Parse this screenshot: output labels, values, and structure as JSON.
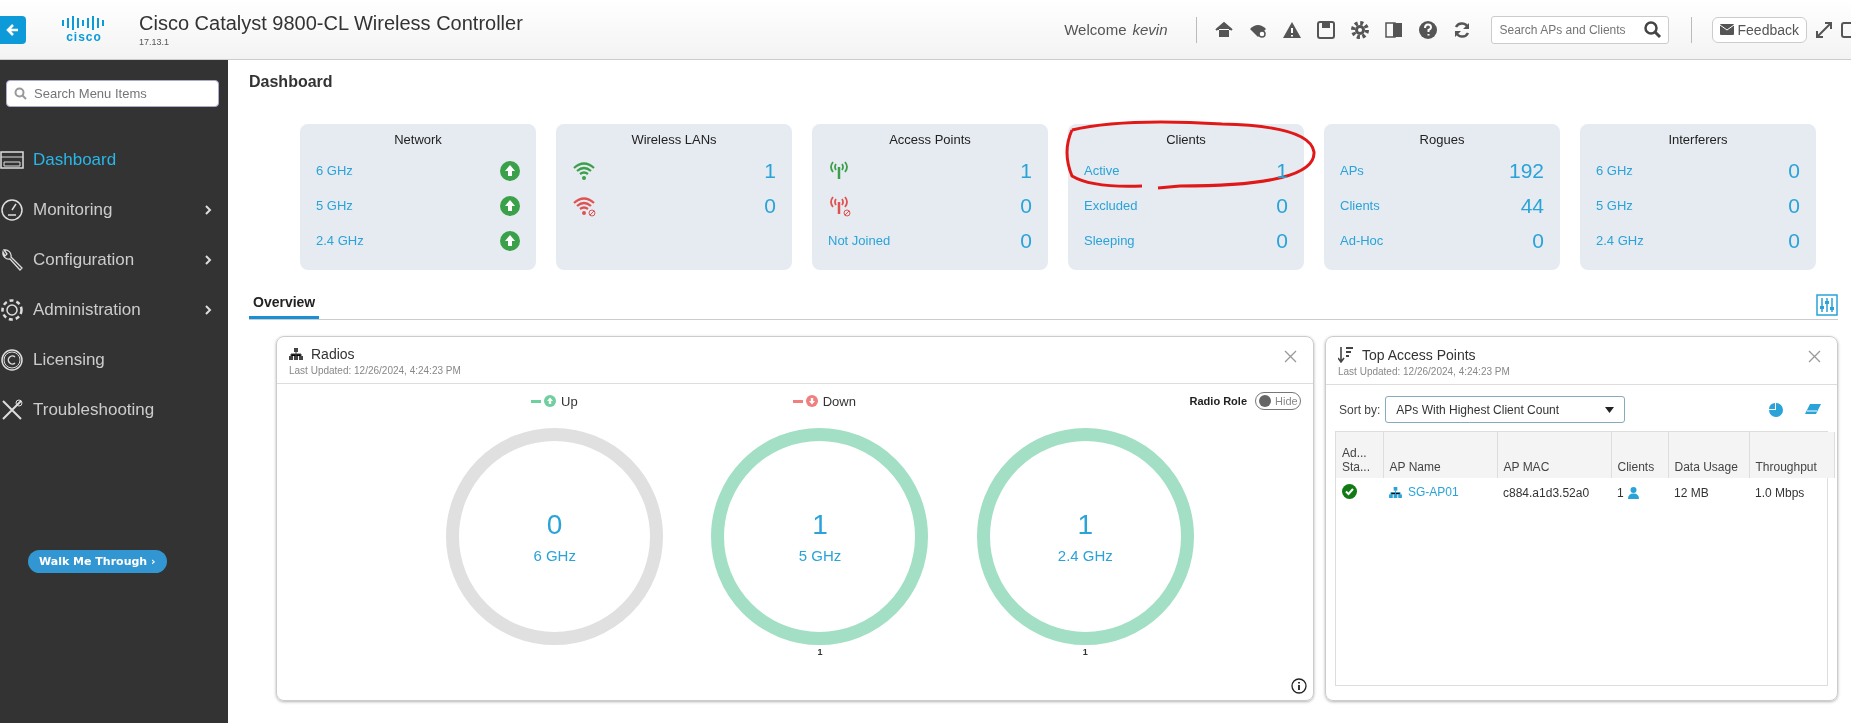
{
  "header": {
    "logo_text": "cisco",
    "version": "17.13.1",
    "title": "Cisco Catalyst 9800-CL Wireless Controller",
    "welcome": "Welcome",
    "user": "kevin",
    "search_placeholder": "Search APs and Clients",
    "feedback": "Feedback"
  },
  "sidebar": {
    "search_placeholder": "Search Menu Items",
    "items": [
      {
        "label": "Dashboard",
        "selected": true,
        "expandable": false
      },
      {
        "label": "Monitoring",
        "selected": false,
        "expandable": true
      },
      {
        "label": "Configuration",
        "selected": false,
        "expandable": true
      },
      {
        "label": "Administration",
        "selected": false,
        "expandable": true
      },
      {
        "label": "Licensing",
        "selected": false,
        "expandable": false
      },
      {
        "label": "Troubleshooting",
        "selected": false,
        "expandable": false
      }
    ],
    "walk_button": "Walk Me Through ›"
  },
  "page_title": "Dashboard",
  "cards": [
    {
      "title": "Network",
      "annotated": false,
      "rows": [
        {
          "kind": "status",
          "label": "6 GHz",
          "up": true
        },
        {
          "kind": "status",
          "label": "5 GHz",
          "up": true
        },
        {
          "kind": "status",
          "label": "2.4 GHz",
          "up": true
        }
      ]
    },
    {
      "title": "Wireless LANs",
      "annotated": false,
      "rows": [
        {
          "kind": "wifi",
          "enabled": true,
          "value": "1"
        },
        {
          "kind": "wifi",
          "enabled": false,
          "value": "0"
        }
      ]
    },
    {
      "title": "Access Points",
      "annotated": false,
      "rows": [
        {
          "kind": "antenna",
          "enabled": true,
          "value": "1"
        },
        {
          "kind": "antenna",
          "enabled": false,
          "value": "0"
        },
        {
          "kind": "metric",
          "label": "Not Joined",
          "value": "0"
        }
      ]
    },
    {
      "title": "Clients",
      "annotated": true,
      "rows": [
        {
          "kind": "metric",
          "label": "Active",
          "value": "1"
        },
        {
          "kind": "metric",
          "label": "Excluded",
          "value": "0"
        },
        {
          "kind": "metric",
          "label": "Sleeping",
          "value": "0"
        }
      ]
    },
    {
      "title": "Rogues",
      "annotated": false,
      "rows": [
        {
          "kind": "metric",
          "label": "APs",
          "value": "192"
        },
        {
          "kind": "metric",
          "label": "Clients",
          "value": "44"
        },
        {
          "kind": "metric",
          "label": "Ad-Hoc",
          "value": "0"
        }
      ]
    },
    {
      "title": "Interferers",
      "annotated": false,
      "rows": [
        {
          "kind": "metric",
          "label": "6 GHz",
          "value": "0"
        },
        {
          "kind": "metric",
          "label": "5 GHz",
          "value": "0"
        },
        {
          "kind": "metric",
          "label": "2.4 GHz",
          "value": "0"
        }
      ]
    }
  ],
  "tabs": [
    {
      "label": "Overview",
      "selected": true
    }
  ],
  "radios": {
    "title": "Radios",
    "updated": "Last Updated: 12/26/2024, 4:24:23 PM",
    "legend": [
      {
        "kind": "up",
        "label": "Up"
      },
      {
        "kind": "down",
        "label": "Down"
      }
    ],
    "radio_role": {
      "label": "Radio Role",
      "toggle_text": "Hide",
      "on": false
    },
    "rings": [
      {
        "count": "0",
        "band": "6 GHz",
        "up": false
      },
      {
        "count": "1",
        "band": "5 GHz",
        "up": true,
        "footnote": "1"
      },
      {
        "count": "1",
        "band": "2.4 GHz",
        "up": true,
        "footnote": "1"
      }
    ]
  },
  "top_aps": {
    "title": "Top Access Points",
    "updated": "Last Updated: 12/26/2024, 4:24:23 PM",
    "sort_label": "Sort by:",
    "sort_value": "APs With Highest Client Count",
    "columns": [
      "Ad... Sta...",
      "AP Name",
      "AP MAC",
      "Clients",
      "Data Usage",
      "Throughput"
    ],
    "rows": [
      {
        "ok": true,
        "ap_name": "SG-AP01",
        "mac": "c884.a1d3.52a0",
        "clients": "1",
        "data_usage": "12 MB",
        "throughput": "1.0 Mbps"
      }
    ]
  }
}
